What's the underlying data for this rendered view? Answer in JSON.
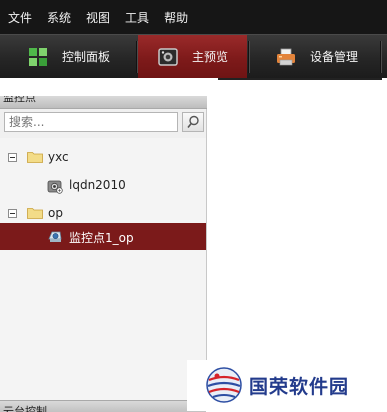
{
  "menu": [
    "文件",
    "系统",
    "视图",
    "工具",
    "帮助"
  ],
  "tabs": [
    {
      "label": "控制面板",
      "icon": "control-panel-grid-icon"
    },
    {
      "label": "主预览",
      "icon": "main-preview-camera-icon",
      "active": true
    },
    {
      "label": "设备管理",
      "icon": "device-management-printer-icon"
    }
  ],
  "panel": {
    "header": "监控点",
    "search_placeholder": "搜索...",
    "search_icon": "search-icon",
    "tree": [
      {
        "label": "yxc",
        "type": "group",
        "expanded": true,
        "icon": "folder-icon"
      },
      {
        "label": "lqdn2010",
        "type": "device",
        "icon": "dvr-device-icon"
      },
      {
        "label": "op",
        "type": "group",
        "expanded": true,
        "icon": "folder-icon"
      },
      {
        "label": "监控点1_op",
        "type": "camera",
        "selected": true,
        "icon": "camera-icon"
      }
    ],
    "bottom_header": "云台控制"
  },
  "watermark": {
    "text": "国荣软件园",
    "icon": "globe-logo-icon"
  },
  "colors": {
    "menubar": "#161616",
    "active_tab": "#7e1a1a",
    "selected_row": "#7b1a1a",
    "watermark": "#233b8c"
  }
}
